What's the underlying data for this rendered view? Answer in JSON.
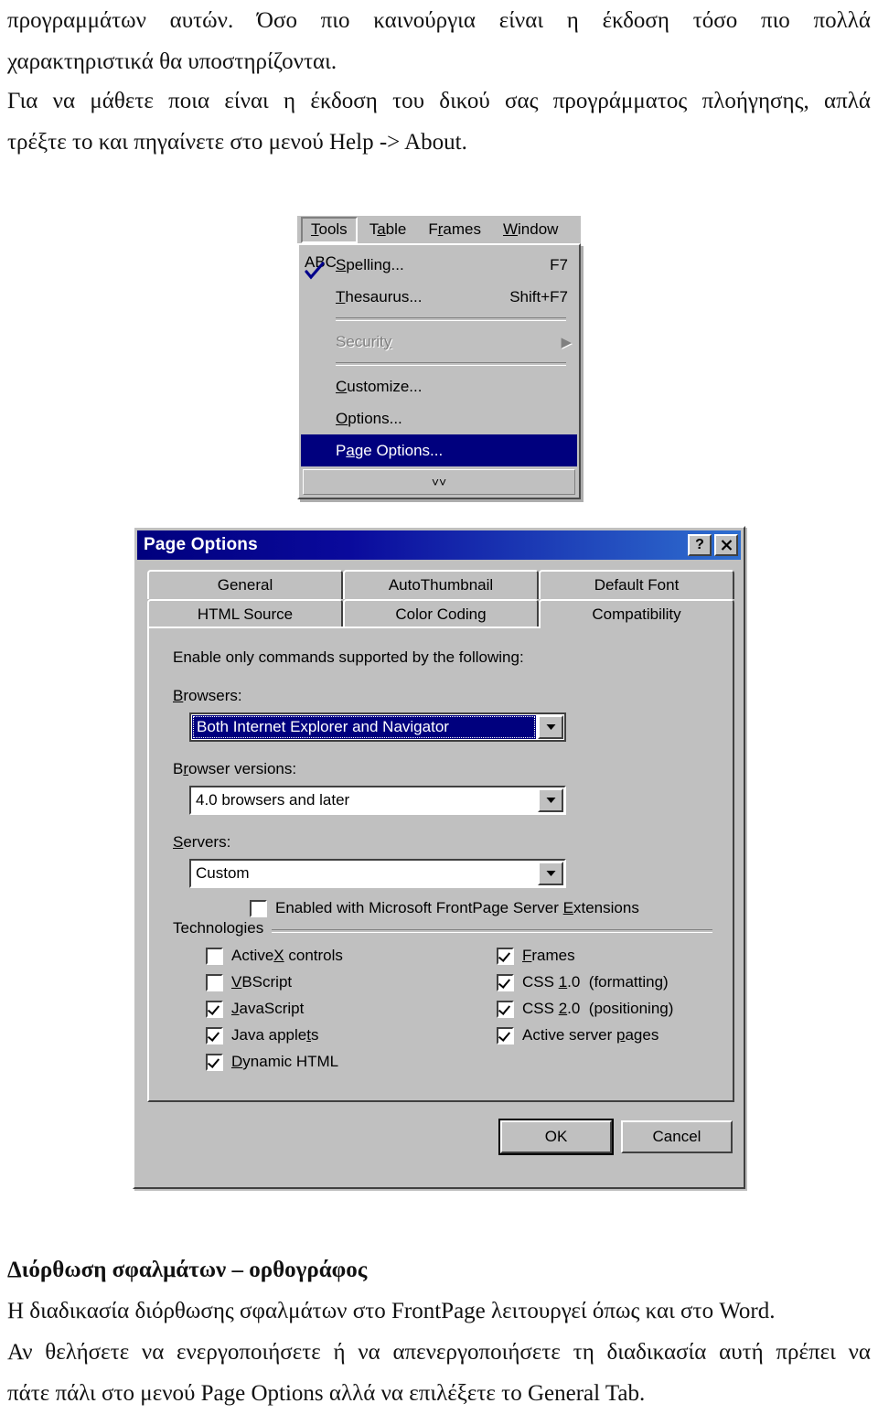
{
  "document": {
    "intro_lines": [
      "προγραμμάτων αυτών. Όσο πιο καινούργια είναι η έκδοση τόσο πιο πολλά",
      "χαρακτηριστικά θα υποστηρίζονται."
    ],
    "about_lines": [
      "Για να μάθετε ποια είναι η έκδοση του δικού σας προγράμματος πλοήγησης, απλά",
      "τρέξτε το και πηγαίνετε στο μενού Help -> About."
    ],
    "bottom_heading": "Διόρθωση σφαλμάτων – ορθογράφος",
    "bottom_lines": [
      "Η διαδικασία διόρθωσης σφαλμάτων στο FrontPage λειτουργεί όπως και στο Word.",
      "Αν θελήσετε να ενεργοποιήσετε ή να απενεργοποιήσετε τη διαδικασία αυτή πρέπει να",
      "πάτε πάλι στο μενού Page Options αλλά να επιλέξετε το General Tab."
    ]
  },
  "menu": {
    "menubar": [
      {
        "label": "Tools",
        "accel": "T",
        "active": true
      },
      {
        "label": "Table",
        "accel": "a",
        "active": false
      },
      {
        "label": "Frames",
        "accel": "r",
        "active": false
      },
      {
        "label": "Window",
        "accel": "W",
        "active": false
      }
    ],
    "items": [
      {
        "label": "Spelling...",
        "accel_key": "F7",
        "icon": "spellcheck-abc-icon",
        "state": "normal"
      },
      {
        "label": "Thesaurus...",
        "accel_key": "Shift+F7",
        "icon": "",
        "state": "normal"
      },
      {
        "label": "Security",
        "accel_key": "",
        "icon": "",
        "state": "disabled",
        "submenu": true
      },
      {
        "label": "Customize...",
        "accel_key": "",
        "icon": "",
        "state": "normal"
      },
      {
        "label": "Options...",
        "accel_key": "",
        "icon": "",
        "state": "normal"
      },
      {
        "label": "Page Options...",
        "accel_key": "",
        "icon": "",
        "state": "selected"
      }
    ],
    "expand_glyph": "chevron-double-down-icon",
    "cursor": "mouse-pointer-icon"
  },
  "dialog": {
    "title": "Page Options",
    "help_button": "?",
    "close_button": "✕",
    "tabs_row1": [
      {
        "label": "General",
        "selected": false
      },
      {
        "label": "AutoThumbnail",
        "selected": false
      },
      {
        "label": "Default Font",
        "selected": false
      }
    ],
    "tabs_row2": [
      {
        "label": "HTML Source",
        "selected": false
      },
      {
        "label": "Color Coding",
        "selected": false
      },
      {
        "label": "Compatibility",
        "selected": true
      }
    ],
    "instruction": "Enable only commands supported by the following:",
    "browsers_label": "Browsers:",
    "browsers_value": "Both Internet Explorer and Navigator",
    "browser_versions_label": "Browser versions:",
    "browser_versions_value": "4.0 browsers and later",
    "servers_label": "Servers:",
    "servers_value": "Custom",
    "server_extensions_label": "Enabled with Microsoft FrontPage Server Extensions",
    "server_extensions_checked": false,
    "technologies_label": "Technologies",
    "tech_left": [
      {
        "label": "ActiveX controls",
        "checked": false
      },
      {
        "label": "VBScript",
        "checked": false
      },
      {
        "label": "JavaScript",
        "checked": true
      },
      {
        "label": "Java applets",
        "checked": true
      },
      {
        "label": "Dynamic HTML",
        "checked": true
      }
    ],
    "tech_right": [
      {
        "label": "Frames",
        "checked": true
      },
      {
        "label": "CSS 1.0  (formatting)",
        "checked": true
      },
      {
        "label": "CSS 2.0  (positioning)",
        "checked": true
      },
      {
        "label": "Active server pages",
        "checked": true
      }
    ],
    "ok_label": "OK",
    "cancel_label": "Cancel"
  },
  "colors": {
    "dialog_face": "#c0c0c0",
    "title_bar_start": "#00007e",
    "title_bar_end": "#2f6fd0",
    "highlight": "#00007e",
    "text": "#000000",
    "disabled_text": "#808080"
  }
}
